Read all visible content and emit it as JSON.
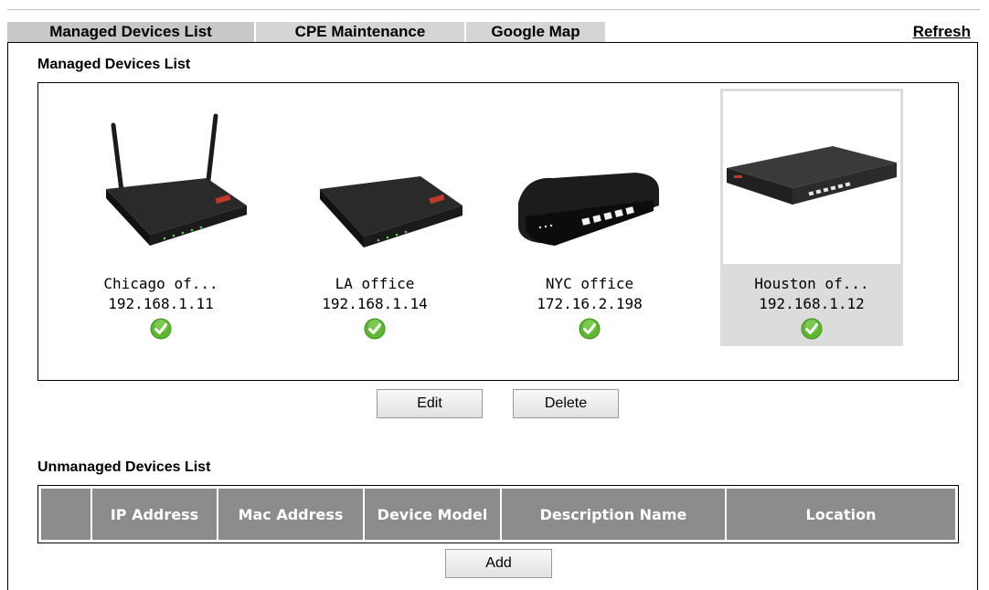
{
  "tabs": [
    {
      "label": "Managed Devices List",
      "active": true
    },
    {
      "label": "CPE Maintenance",
      "active": false
    },
    {
      "label": "Google Map",
      "active": false
    }
  ],
  "refresh_label": "Refresh",
  "managed": {
    "title": "Managed Devices List",
    "devices": [
      {
        "name": "Chicago of...",
        "ip": "192.168.1.11",
        "status_icon": "check-icon",
        "model_icon": "router-antenna"
      },
      {
        "name": "LA office",
        "ip": "192.168.1.14",
        "status_icon": "check-icon",
        "model_icon": "router-flat"
      },
      {
        "name": "NYC office",
        "ip": "172.16.2.198",
        "status_icon": "check-icon",
        "model_icon": "router-compact"
      },
      {
        "name": "Houston of...",
        "ip": "192.168.1.12",
        "status_icon": "check-icon",
        "model_icon": "rack-switch",
        "selected": true
      }
    ],
    "edit_label": "Edit",
    "delete_label": "Delete"
  },
  "unmanaged": {
    "title": "Unmanaged Devices List",
    "columns": [
      "",
      "IP Address",
      "Mac Address",
      "Device Model",
      "Description Name",
      "Location"
    ],
    "rows": [],
    "add_label": "Add"
  },
  "colors": {
    "header_bg": "#8c8c8c",
    "tab_bg": "#d5d5d5",
    "selected_bg": "#dcdcdc",
    "check_green": "#5cb82e"
  }
}
